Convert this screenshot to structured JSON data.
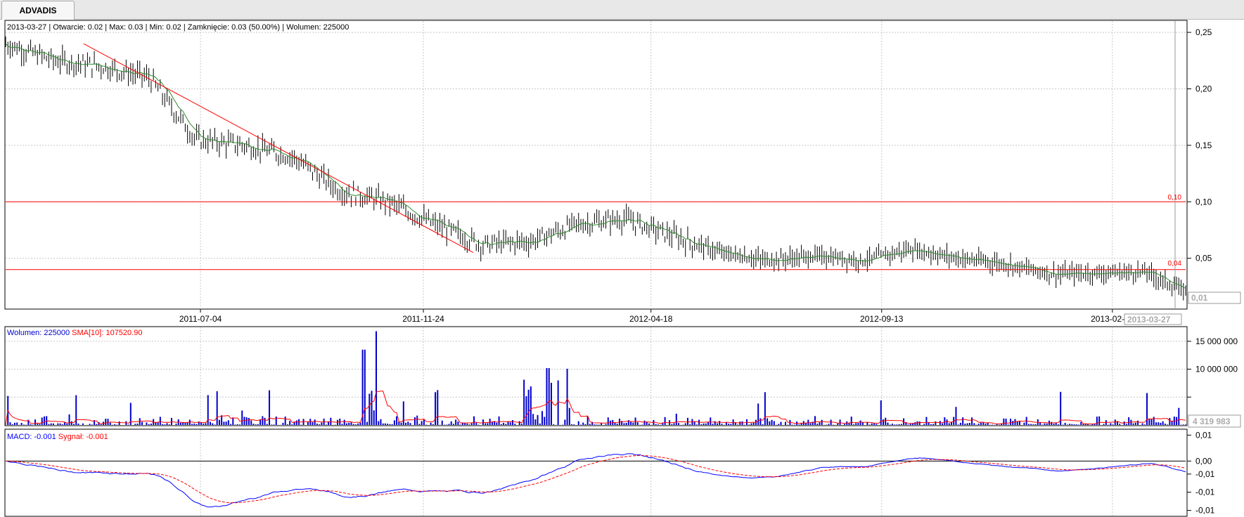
{
  "tab": {
    "label": "ADVADIS"
  },
  "price_panel": {
    "info": {
      "date": "2013-03-27",
      "open_label": "Otwarcie:",
      "open": "0.02",
      "max_label": "Max:",
      "max": "0.03",
      "min_label": "Min:",
      "min": "0.02",
      "close_label": "Zamknięcie:",
      "close": "0.03 (50.00%)",
      "volume_label": "Wolumen:",
      "volume": "225000"
    },
    "hline_labels": [
      "0,10",
      "0,04"
    ],
    "current_price_box": "0,01",
    "current_date_box": "2013-03-27"
  },
  "volume_panel": {
    "label": "Wolumen: 225000",
    "sma_label": "SMA[10]: 107520.90",
    "current_value_box": "4 319 983"
  },
  "macd_panel": {
    "macd_label": "MACD: -0.001",
    "signal_label": "Sygnał: -0.001"
  },
  "colors": {
    "bars": "#000000",
    "ma_line": "#2e8b2e",
    "support_lines": "#ff0000",
    "volume_bars": "#0000cc",
    "sma_line": "#ff0000",
    "macd_line": "#0000ff",
    "signal_line": "#ff0000",
    "grid": "#c8c8c8",
    "zero_line": "#000000"
  },
  "chart_data": [
    {
      "type": "ohlc",
      "name": "price",
      "x_tick_labels": [
        "2011-07-04",
        "2011-11-24",
        "2012-04-18",
        "2012-09-13",
        "2013-02-08"
      ],
      "y_tick_labels": [
        "0,25",
        "0,20",
        "0,15",
        "0,10",
        "0,05"
      ],
      "ylim": [
        0.005,
        0.26
      ],
      "grid": true,
      "horizontal_lines": [
        0.1,
        0.04
      ],
      "trendline": {
        "from": [
          "2011-04-20",
          0.24
        ],
        "to": [
          "2011-12-26",
          0.055
        ]
      },
      "x_axis_dates": [
        "2011-03-01",
        "2011-04-01",
        "2011-05-01",
        "2011-06-01",
        "2011-07-01",
        "2011-08-01",
        "2011-09-01",
        "2011-10-01",
        "2011-11-01",
        "2011-12-01",
        "2012-01-01",
        "2012-02-01",
        "2012-03-01",
        "2012-04-01",
        "2012-05-01",
        "2012-06-01",
        "2012-07-01",
        "2012-08-01",
        "2012-09-01",
        "2012-10-01",
        "2012-11-01",
        "2012-12-01",
        "2013-01-01",
        "2013-02-01",
        "2013-03-01",
        "2013-03-27"
      ],
      "close_series": [
        0.24,
        0.225,
        0.22,
        0.21,
        0.155,
        0.15,
        0.14,
        0.11,
        0.1,
        0.08,
        0.062,
        0.065,
        0.08,
        0.085,
        0.07,
        0.055,
        0.048,
        0.052,
        0.048,
        0.058,
        0.05,
        0.045,
        0.036,
        0.037,
        0.038,
        0.02
      ]
    },
    {
      "type": "bar",
      "name": "volume",
      "y_tick_labels": [
        "15 000 000",
        "10 000 000",
        "5 000 000"
      ],
      "ylim": [
        0,
        17500000
      ],
      "series_labels": [
        "Wolumen",
        "SMA[10]"
      ]
    },
    {
      "type": "line",
      "name": "macd",
      "y_tick_labels": [
        "0,01",
        "0,00",
        "-0,01",
        "-0,01",
        "-0,01"
      ],
      "ylim": [
        -0.021,
        0.012
      ],
      "series_labels": [
        "MACD",
        "Sygnał"
      ]
    }
  ]
}
